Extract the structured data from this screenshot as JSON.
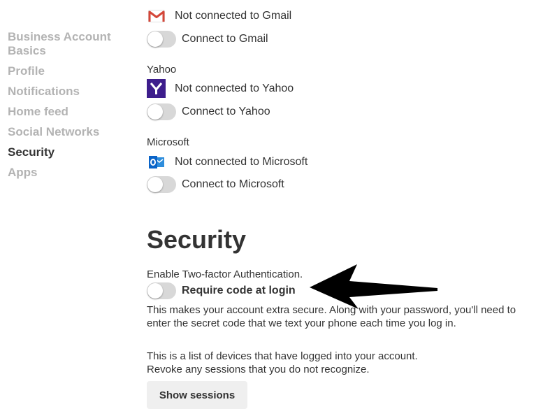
{
  "sidebar": {
    "items": [
      {
        "label": "Business Account Basics"
      },
      {
        "label": "Profile"
      },
      {
        "label": "Notifications"
      },
      {
        "label": "Home feed"
      },
      {
        "label": "Social Networks"
      },
      {
        "label": "Security"
      },
      {
        "label": "Apps"
      }
    ],
    "active": "Security"
  },
  "social": {
    "gmail": {
      "status": "Not connected to Gmail",
      "toggle_label": "Connect to Gmail",
      "connected": false
    },
    "yahoo": {
      "provider": "Yahoo",
      "status": "Not connected to Yahoo",
      "toggle_label": "Connect to Yahoo",
      "connected": false
    },
    "microsoft": {
      "provider": "Microsoft",
      "status": "Not connected to Microsoft",
      "toggle_label": "Connect to Microsoft",
      "connected": false
    }
  },
  "security": {
    "title": "Security",
    "two_factor_intro": "Enable Two-factor Authentication.",
    "toggle_label": "Require code at login",
    "toggle_on": false,
    "description_line1": "This makes your account extra secure. Along with your password, you'll need to",
    "description_line2": "enter the secret code that we text your phone each time you log in.",
    "sessions_line1": "This is a list of devices that have logged into your account.",
    "sessions_line2": "Revoke any sessions that you do not recognize.",
    "show_sessions_label": "Show sessions"
  },
  "icons": {
    "gmail": "gmail-logo-icon",
    "yahoo": "yahoo-logo-icon",
    "microsoft": "outlook-logo-icon",
    "annotation": "arrow-left-icon"
  },
  "colors": {
    "sidebar_inactive": "#b3b3b3",
    "text": "#333333",
    "toggle_off": "#d8d8d8",
    "yahoo_purple": "#3d1d8c",
    "gmail_red": "#d44638",
    "outlook_blue": "#0a64c8"
  }
}
